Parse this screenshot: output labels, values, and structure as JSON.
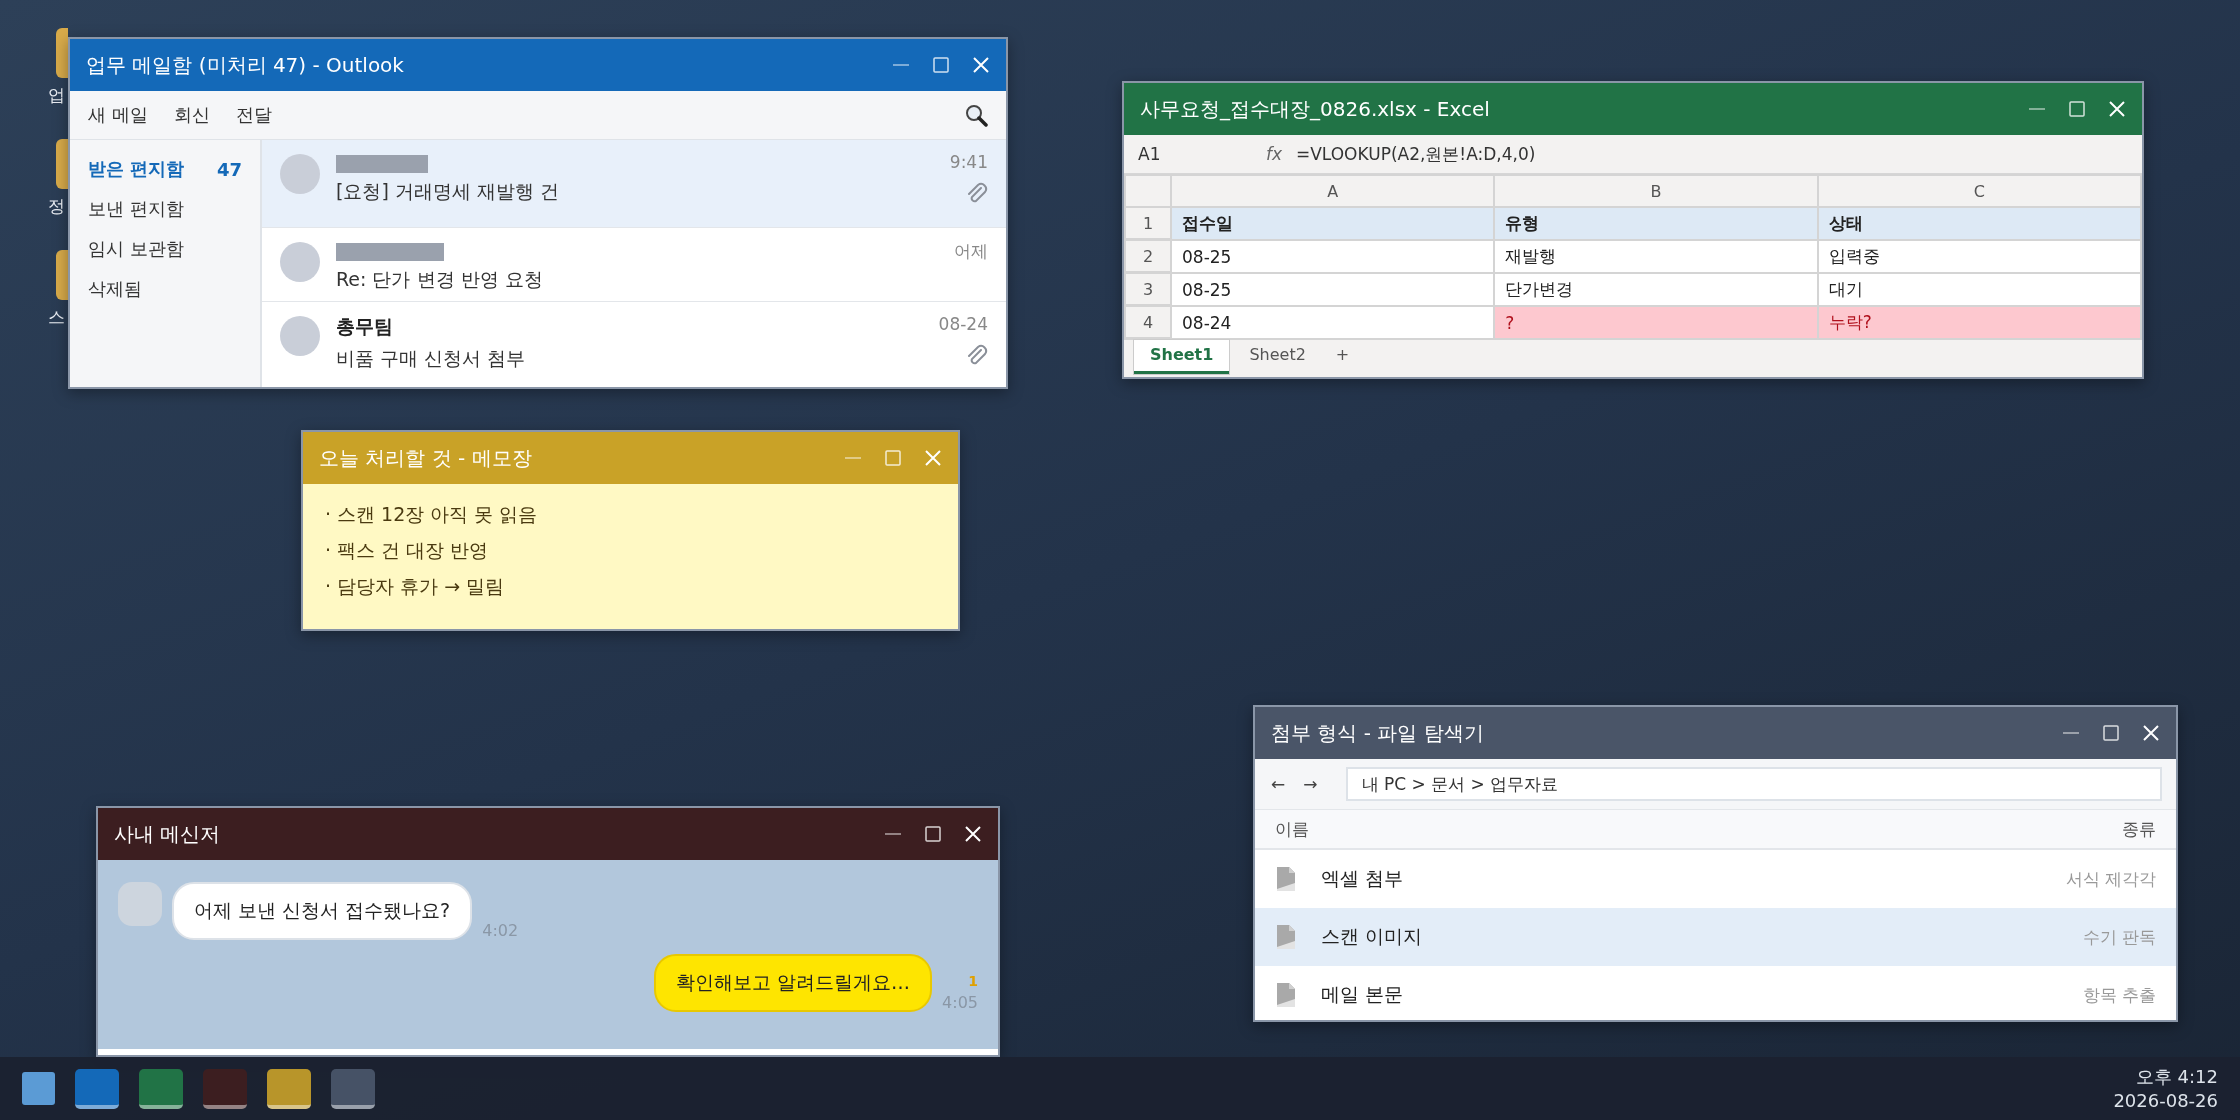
{
  "desktop_icons": [
    {
      "label": "업"
    },
    {
      "label": "정"
    },
    {
      "label": "스"
    }
  ],
  "outlook": {
    "title": "업무 메일함 (미처리 47) - Outlook",
    "toolbar": [
      "새 메일",
      "회신",
      "전달"
    ],
    "folders": [
      {
        "label": "받은 편지함",
        "count": "47",
        "selected": true
      },
      {
        "label": "보낸 편지함",
        "selected": false
      },
      {
        "label": "임시 보관함",
        "selected": false
      },
      {
        "label": "삭제됨",
        "selected": false
      }
    ],
    "messages": [
      {
        "sender_redacted": true,
        "subject": "[요청] 거래명세 재발행 건",
        "time": "9:41",
        "attachment": true,
        "selected": true
      },
      {
        "sender_redacted": true,
        "subject": "Re: 단가 변경 반영 요청",
        "time": "어제",
        "attachment": false,
        "selected": false
      },
      {
        "sender_redacted": false,
        "sender": "총무팀",
        "subject": "비품 구매 신청서 첨부",
        "time": "08-24",
        "attachment": true,
        "selected": false
      }
    ]
  },
  "excel": {
    "title": "사무요청_접수대장_0826.xlsx - Excel",
    "cell_ref": "A1",
    "fx": "fx",
    "formula": "=VLOOKUP(A2,원본!A:D,4,0)",
    "columns": [
      "A",
      "B",
      "C"
    ],
    "rows": [
      {
        "number": "1",
        "cells": [
          {
            "text": "접수일",
            "kind": "header"
          },
          {
            "text": "유형",
            "kind": "header"
          },
          {
            "text": "상태",
            "kind": "header"
          }
        ]
      },
      {
        "number": "2",
        "cells": [
          {
            "text": "08-25",
            "kind": "normal"
          },
          {
            "text": "재발행",
            "kind": "normal"
          },
          {
            "text": "입력중",
            "kind": "normal"
          }
        ]
      },
      {
        "number": "3",
        "cells": [
          {
            "text": "08-25",
            "kind": "normal"
          },
          {
            "text": "단가변경",
            "kind": "normal"
          },
          {
            "text": "대기",
            "kind": "normal"
          }
        ]
      },
      {
        "number": "4",
        "cells": [
          {
            "text": "08-24",
            "kind": "normal"
          },
          {
            "text": "?",
            "kind": "flagged"
          },
          {
            "text": "누락?",
            "kind": "flagged"
          }
        ]
      }
    ],
    "sheets": [
      {
        "label": "Sheet1",
        "selected": true
      },
      {
        "label": "Sheet2",
        "selected": false
      }
    ],
    "add_sheet": "+"
  },
  "notepad": {
    "title": "오늘 처리할 것 - 메모장",
    "lines": [
      "· 스캔 12장 아직 못 읽음",
      "· 팩스 건 대장 반영",
      "· 담당자 휴가 → 밀림"
    ]
  },
  "messenger": {
    "title": "사내 메신저",
    "messages": [
      {
        "kind": "received",
        "text": "어제 보낸 신청서 접수됐나요?",
        "time": "4:02"
      },
      {
        "kind": "sent",
        "text": "확인해보고 알려드릴게요…",
        "time": "4:05",
        "unread": "1"
      }
    ]
  },
  "explorer": {
    "title": "첨부 형식 - 파일 탐색기",
    "back": "←",
    "forward": "→",
    "path": "내 PC > 문서 > 업무자료",
    "columns": [
      "이름",
      "종류"
    ],
    "files": [
      {
        "name": "엑셀 첨부",
        "type": "서식 제각각",
        "selected": false
      },
      {
        "name": "스캔 이미지",
        "type": "수기 판독",
        "selected": true
      },
      {
        "name": "메일 본문",
        "type": "항목 추출",
        "selected": false
      }
    ]
  },
  "taskbar": {
    "apps": [
      {
        "color": "#1469b8"
      },
      {
        "color": "#217346"
      },
      {
        "color": "#3c1e20"
      },
      {
        "color": "#b8952a"
      },
      {
        "color": "#465266"
      }
    ],
    "time": "오후 4:12",
    "date": "2026-08-26"
  }
}
